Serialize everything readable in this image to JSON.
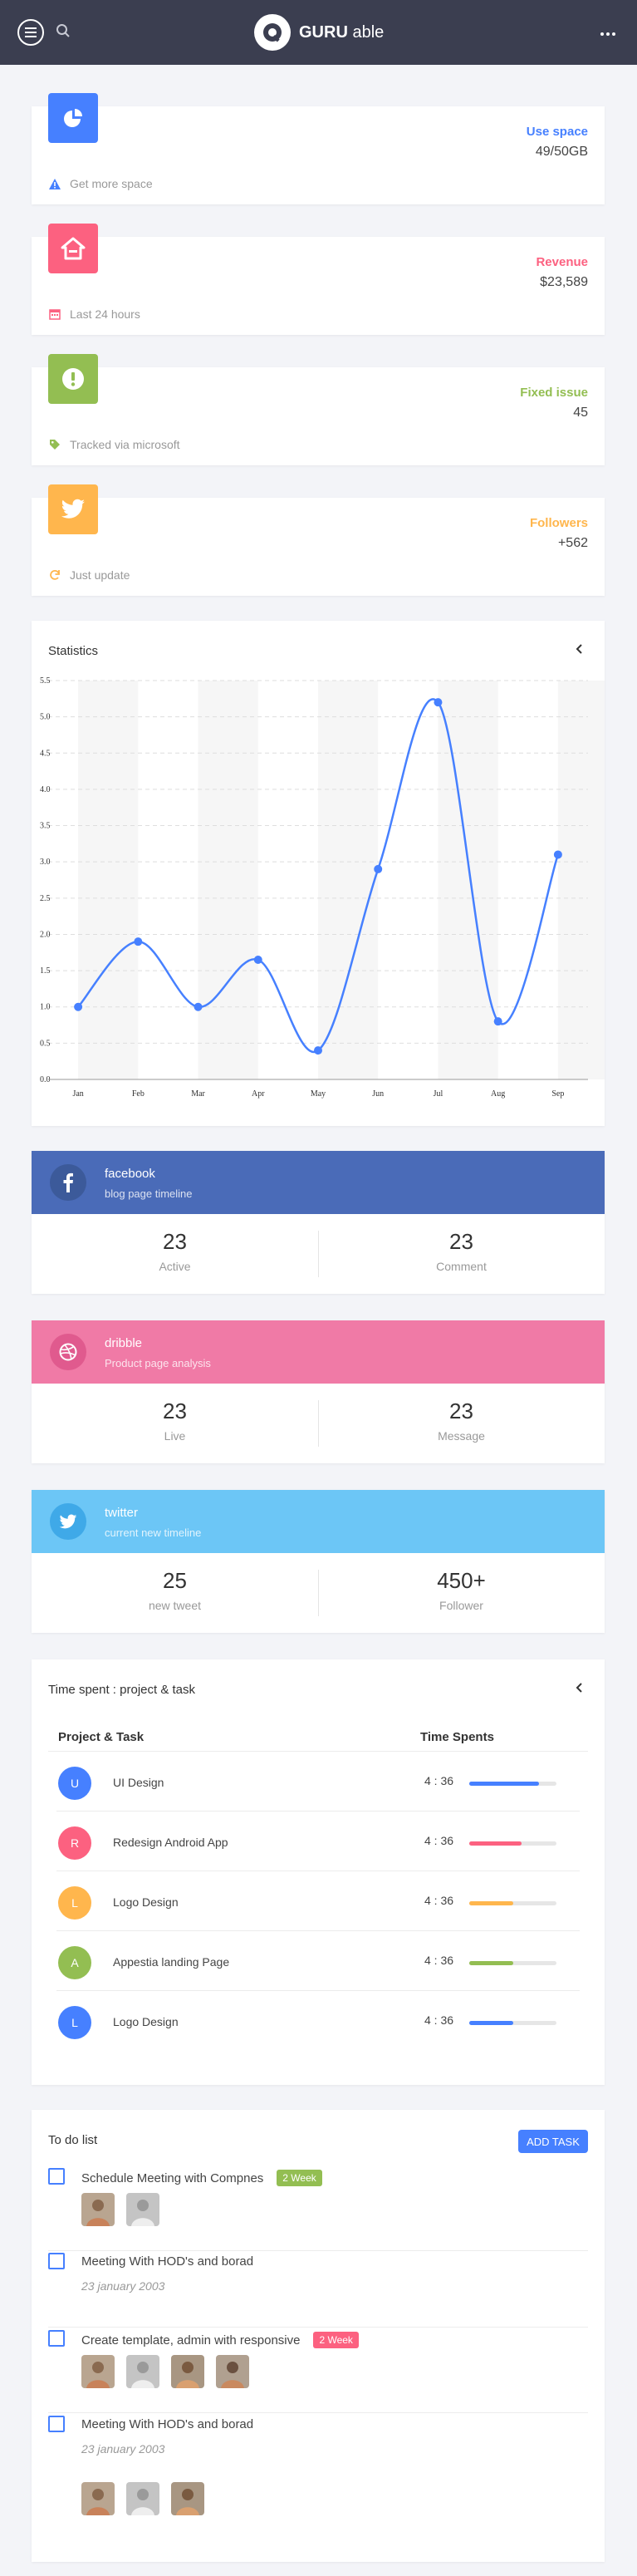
{
  "topbar": {
    "logo_bold": "GURU",
    "logo_light": " able",
    "more_label": "..."
  },
  "stats": [
    {
      "title": "Use space",
      "value": "49/50GB",
      "footer": "Get more space",
      "color": "#4680ff",
      "icon": "pie-chart-icon",
      "footer_icon": "warning-icon"
    },
    {
      "title": "Revenue",
      "value": "$23,589",
      "footer": "Last 24 hours",
      "color": "#fc6180",
      "icon": "home-icon",
      "footer_icon": "calendar-icon"
    },
    {
      "title": "Fixed issue",
      "value": "45",
      "footer": "Tracked via microsoft",
      "color": "#93be52",
      "icon": "alert-circle-icon",
      "footer_icon": "tag-icon"
    },
    {
      "title": "Followers",
      "value": "+562",
      "footer": "Just update",
      "color": "#ffb64d",
      "icon": "twitter-icon",
      "footer_icon": "refresh-icon"
    }
  ],
  "statistics": {
    "title": "Statistics",
    "chart_data": {
      "type": "line",
      "categories": [
        "Jan",
        "Feb",
        "Mar",
        "Apr",
        "May",
        "Jun",
        "Jul",
        "Aug",
        "Sep"
      ],
      "values": [
        1.0,
        1.9,
        1.0,
        1.65,
        0.4,
        2.9,
        5.2,
        0.8,
        3.1
      ],
      "yticks": [
        "0.0",
        "0.5",
        "1.0",
        "1.5",
        "2.0",
        "2.5",
        "3.0",
        "3.5",
        "4.0",
        "4.5",
        "5.0",
        "5.5"
      ],
      "ylim": [
        0,
        5.5
      ],
      "color": "#4680ff"
    }
  },
  "social": [
    {
      "name": "facebook",
      "sub": "blog page timeline",
      "left_value": "23",
      "left_label": "Active",
      "right_value": "23",
      "right_label": "Comment",
      "color": "#4a6bb8",
      "icon": "facebook-icon"
    },
    {
      "name": "dribble",
      "sub": "Product page analysis",
      "left_value": "23",
      "left_label": "Live",
      "right_value": "23",
      "right_label": "Message",
      "color": "#f07aa6",
      "icon": "dribbble-icon"
    },
    {
      "name": "twitter",
      "sub": "current new timeline",
      "left_value": "25",
      "left_label": "new tweet",
      "right_value": "450+",
      "right_label": "Follower",
      "color": "#6cc6f6",
      "icon": "twitter-icon"
    }
  ],
  "timespent": {
    "title": "Time spent : project & task",
    "col_project": "Project & Task",
    "col_time": "Time Spents",
    "rows": [
      {
        "initial": "U",
        "name": "UI Design",
        "time": "4 : 36",
        "color": "#4680ff",
        "progress": 0.8
      },
      {
        "initial": "R",
        "name": "Redesign Android App",
        "time": "4 : 36",
        "color": "#fc6180",
        "progress": 0.6
      },
      {
        "initial": "L",
        "name": "Logo Design",
        "time": "4 : 36",
        "color": "#ffb64d",
        "progress": 0.5
      },
      {
        "initial": "A",
        "name": "Appestia landing Page",
        "time": "4 : 36",
        "color": "#93be52",
        "progress": 0.5
      },
      {
        "initial": "L",
        "name": "Logo Design",
        "time": "4 : 36",
        "color": "#4680ff",
        "progress": 0.5
      }
    ]
  },
  "todo": {
    "title": "To do list",
    "add_label": "ADD TASK",
    "items": [
      {
        "text": "Schedule Meeting with Compnes",
        "badge": "2 Week",
        "badge_color": "#93be52",
        "date": "",
        "photos": 2
      },
      {
        "text": "Meeting With HOD's and borad",
        "badge": "",
        "badge_color": "",
        "date": "23 january 2003",
        "photos": 0
      },
      {
        "text": "Create template, admin with responsive",
        "badge": "2 Week",
        "badge_color": "#fc6180",
        "date": "",
        "photos": 4
      },
      {
        "text": "Meeting With HOD's and borad",
        "badge": "",
        "badge_color": "",
        "date": "23 january 2003",
        "photos": 3
      }
    ]
  }
}
